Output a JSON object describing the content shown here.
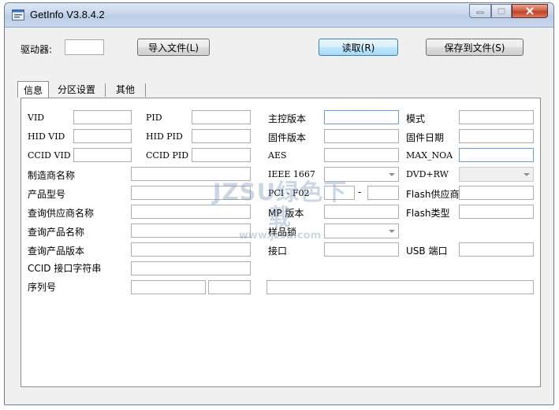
{
  "window": {
    "title": "GetInfo V3.8.4.2"
  },
  "toolbar": {
    "drive_label": "驱动器:",
    "drive_value": "",
    "import_label": "导入文件(L)",
    "read_label": "读取(R)",
    "save_label": "保存到文件(S)"
  },
  "tabs": [
    {
      "label": "信息"
    },
    {
      "label": "分区设置"
    },
    {
      "label": "其他"
    }
  ],
  "fields": {
    "vid": "VID",
    "pid": "PID",
    "controller_version": "主控版本",
    "mode": "模式",
    "hid_vid": "HID VID",
    "hid_pid": "HID PID",
    "firmware_version": "固件版本",
    "firmware_date": "固件日期",
    "ccid_vid": "CCID VID",
    "ccid_pid": "CCID PID",
    "aes": "AES",
    "max_noa": "MAX_NOA",
    "manufacturer_name": "制造商名称",
    "ieee_1667": "IEEE 1667",
    "dvd_rw": "DVD+RW",
    "product_model": "产品型号",
    "pci_f02": "PCI - F02",
    "dash": "-",
    "flash_vendor": "Flash供应商",
    "query_vendor_name": "查询供应商名称",
    "mp_version": "MP 版本",
    "flash_type": "Flash类型",
    "query_product_name": "查询产品名称",
    "sample_lock": "样品锁",
    "query_product_version": "查询产品版本",
    "interface": "接口",
    "usb_port": "USB 端口",
    "ccid_interface_string": "CCID 接口字符串",
    "serial_number": "序列号"
  },
  "watermark": {
    "main": "JZSU绿色下载",
    "url": "www.jzsu.com"
  }
}
